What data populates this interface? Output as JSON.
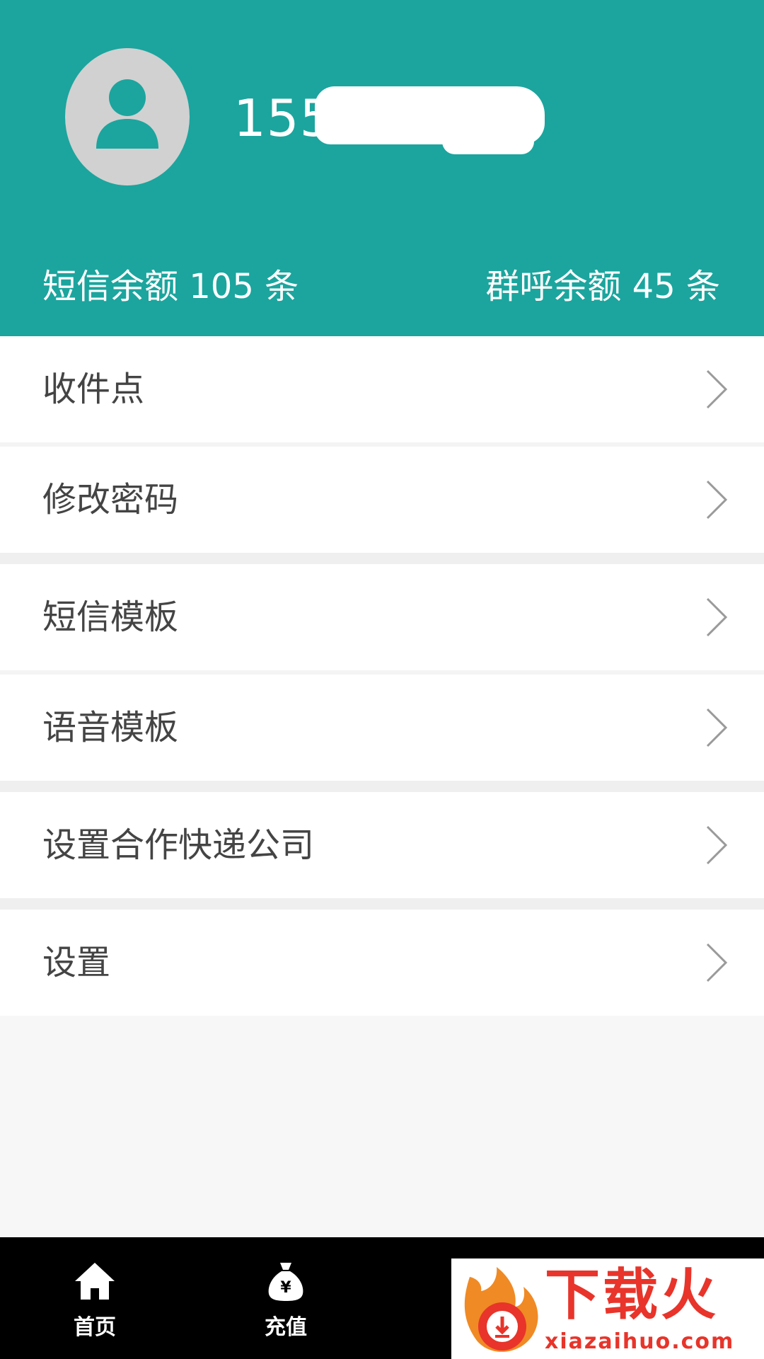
{
  "profile": {
    "phone_visible": "155",
    "sms_balance": "短信余额 105 条",
    "call_balance": "群呼余额 45 条"
  },
  "menu": {
    "items": [
      {
        "label": "收件点",
        "icon": "chevron-right-icon"
      },
      {
        "label": "修改密码",
        "icon": "chevron-right-icon"
      },
      {
        "label": "短信模板",
        "icon": "chevron-right-icon"
      },
      {
        "label": "语音模板",
        "icon": "chevron-right-icon"
      },
      {
        "label": "设置合作快递公司",
        "icon": "chevron-right-icon"
      },
      {
        "label": "设置",
        "icon": "chevron-right-icon"
      }
    ]
  },
  "bottom_nav": {
    "items": [
      {
        "label": "首页",
        "icon": "home-icon"
      },
      {
        "label": "充值",
        "icon": "money-bag-icon"
      }
    ]
  },
  "watermark": {
    "title": "下载火",
    "url": "xiazaihuo.com"
  },
  "colors": {
    "header": "#1ba59e",
    "nav_background": "#000000",
    "watermark_red": "#e8342a"
  }
}
